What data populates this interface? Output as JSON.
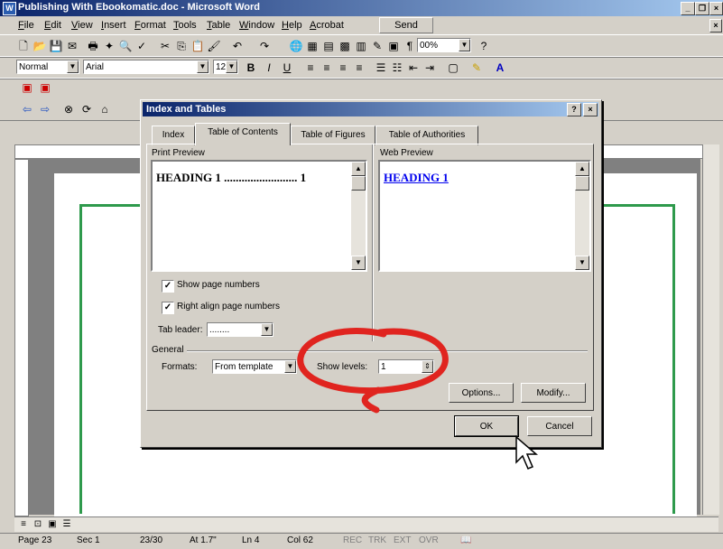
{
  "window": {
    "title": "Publishing With Ebookomatic.doc - Microsoft Word"
  },
  "menu": [
    "File",
    "Edit",
    "View",
    "Insert",
    "Format",
    "Tools",
    "Table",
    "Window",
    "Help",
    "Acrobat"
  ],
  "send_label": "Send",
  "toolbar": {
    "zoom": "00%",
    "style": "Normal",
    "font": "Arial",
    "size": "12",
    "bold": "B",
    "italic": "I",
    "underline": "U"
  },
  "dialog": {
    "title": "Index and Tables",
    "help": "?",
    "close": "×",
    "tabs": [
      "Index",
      "Table of Contents",
      "Table of Figures",
      "Table of Authorities"
    ],
    "active_tab": "Table of Contents",
    "print_preview_label": "Print Preview",
    "print_preview_text": "HEADING 1 ......................... 1",
    "web_preview_label": "Web Preview",
    "web_preview_text": "HEADING 1",
    "show_page_numbers": "Show page numbers",
    "right_align": "Right align page numbers",
    "tab_leader_label": "Tab leader:",
    "tab_leader_value": "........",
    "general_label": "General",
    "formats_label": "Formats:",
    "formats_value": "From template",
    "show_levels_label": "Show levels:",
    "show_levels_value": "1",
    "options_btn": "Options...",
    "modify_btn": "Modify...",
    "ok_btn": "OK",
    "cancel_btn": "Cancel"
  },
  "status": {
    "page": "Page 23",
    "sec": "Sec 1",
    "pages": "23/30",
    "at": "At 1.7\"",
    "ln": "Ln 4",
    "col": "Col 62",
    "rec": "REC",
    "trk": "TRK",
    "ext": "EXT",
    "ovr": "OVR"
  },
  "colors": {
    "title_start": "#0a246a",
    "title_end": "#a6caf0",
    "page_border": "#2e9a4c",
    "annotation": "#e0241f",
    "link": "#0000ee"
  }
}
